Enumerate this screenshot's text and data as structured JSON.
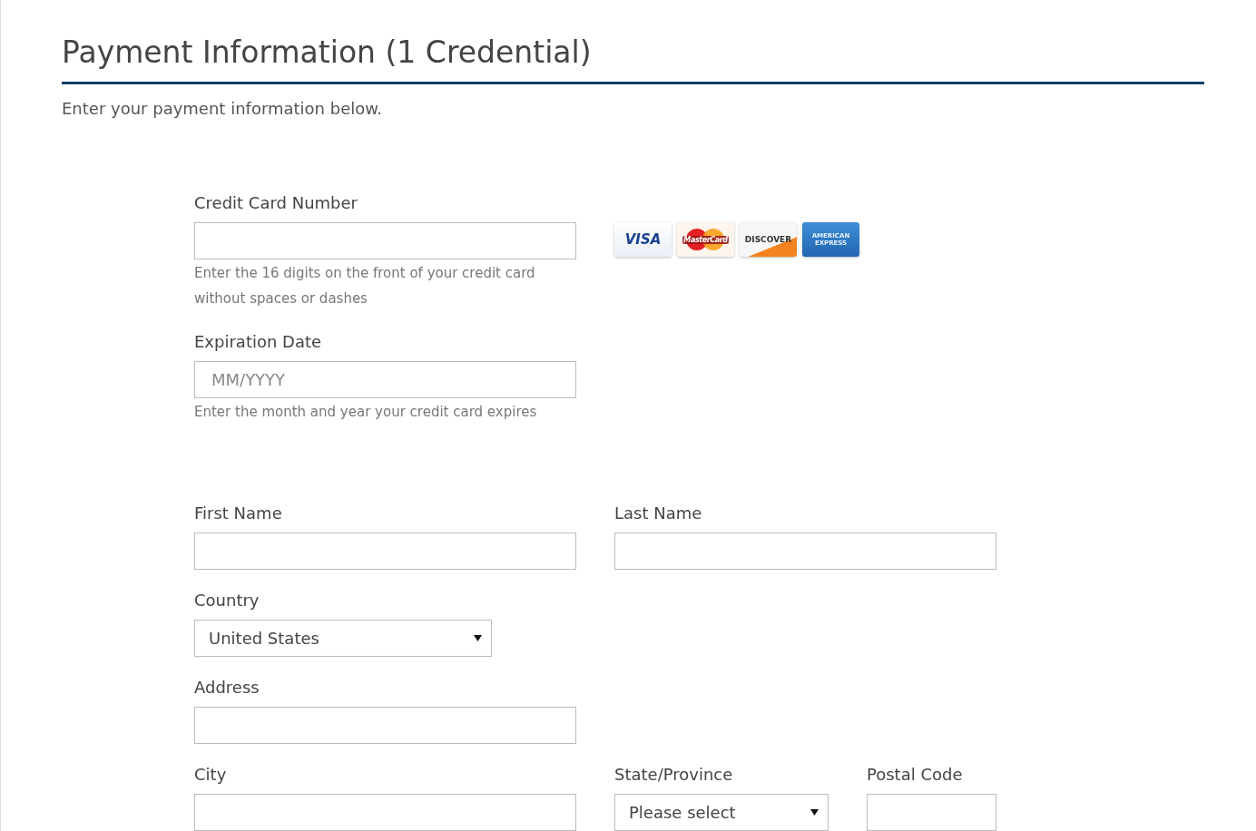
{
  "title": "Payment Information (1 Credential)",
  "subtitle": "Enter your payment information below.",
  "card_section": {
    "rows": [
      [
        {
          "kind": "text",
          "label": "Credit Card Number",
          "help": "Enter the 16 digits on the front of your credit card without spaces or dashes"
        }
      ],
      [
        {
          "kind": "text",
          "label": "Expiration Date",
          "placeholder": "MM/YYYY",
          "help": "Enter the month and year your credit card expires"
        }
      ]
    ],
    "cards": [
      {
        "kind": "visa",
        "label": "VISA"
      },
      {
        "kind": "mastercard",
        "label": "MasterCard"
      },
      {
        "kind": "discover",
        "label": "DISCOVER"
      },
      {
        "kind": "amex",
        "label": "AMERICAN EXPRESS"
      }
    ]
  },
  "billing_section": {
    "rows": [
      [
        {
          "kind": "text",
          "label": "First Name"
        },
        {
          "kind": "text",
          "label": "Last Name"
        }
      ],
      [
        {
          "kind": "select",
          "label": "Country",
          "value": "United States"
        }
      ],
      [
        {
          "kind": "text",
          "label": "Address"
        }
      ],
      [
        {
          "kind": "text",
          "label": "City"
        },
        {
          "kind": "select",
          "label": "State/Province",
          "value": "Please select"
        },
        {
          "kind": "text",
          "label": "Postal Code"
        }
      ]
    ]
  }
}
